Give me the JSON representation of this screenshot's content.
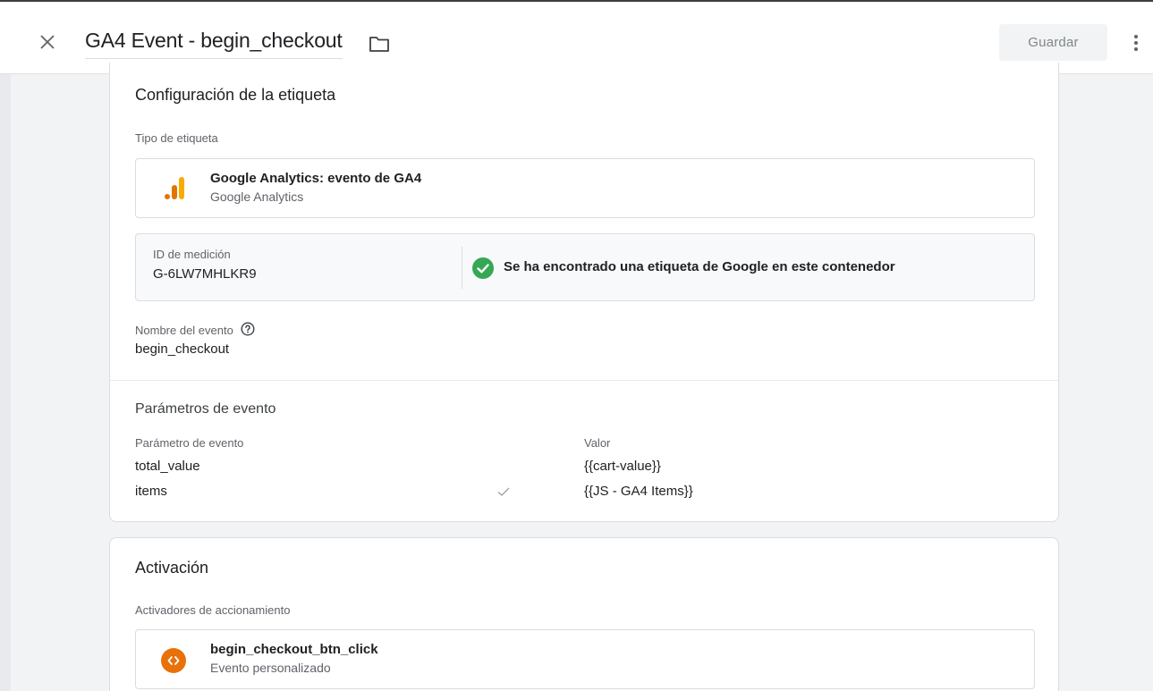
{
  "header": {
    "close_icon": "close-icon",
    "title": "GA4 Event - begin_checkout",
    "folder_icon": "folder-icon",
    "save_label": "Guardar",
    "more_icon": "more-vert-icon"
  },
  "tag_config": {
    "section_title": "Configuración de la etiqueta",
    "tag_type_label": "Tipo de etiqueta",
    "tag_type": {
      "name": "Google Analytics: evento de GA4",
      "vendor": "Google Analytics",
      "icon": "google-analytics-icon",
      "icon_color": "#f9ab00"
    },
    "measurement": {
      "label": "ID de medición",
      "value": "G-6LW7MHLKR9",
      "status_text": "Se ha encontrado una etiqueta de Google en este contenedor",
      "status_icon": "check-circle-icon",
      "status_color": "#34a853"
    },
    "event_name_label": "Nombre del evento",
    "event_name_value": "begin_checkout",
    "params_title": "Parámetros de evento",
    "params_headers": {
      "param": "Parámetro de evento",
      "value": "Valor"
    },
    "params": [
      {
        "name": "total_value",
        "value": "{{cart-value}}",
        "checked": false
      },
      {
        "name": "items",
        "value": "{{JS - GA4 Items}}",
        "checked": true
      }
    ]
  },
  "triggering": {
    "section_title": "Activación",
    "triggers_label": "Activadores de accionamiento",
    "trigger": {
      "name": "begin_checkout_btn_click",
      "type": "Evento personalizado",
      "icon": "code-icon",
      "icon_color": "#e8710a"
    }
  }
}
